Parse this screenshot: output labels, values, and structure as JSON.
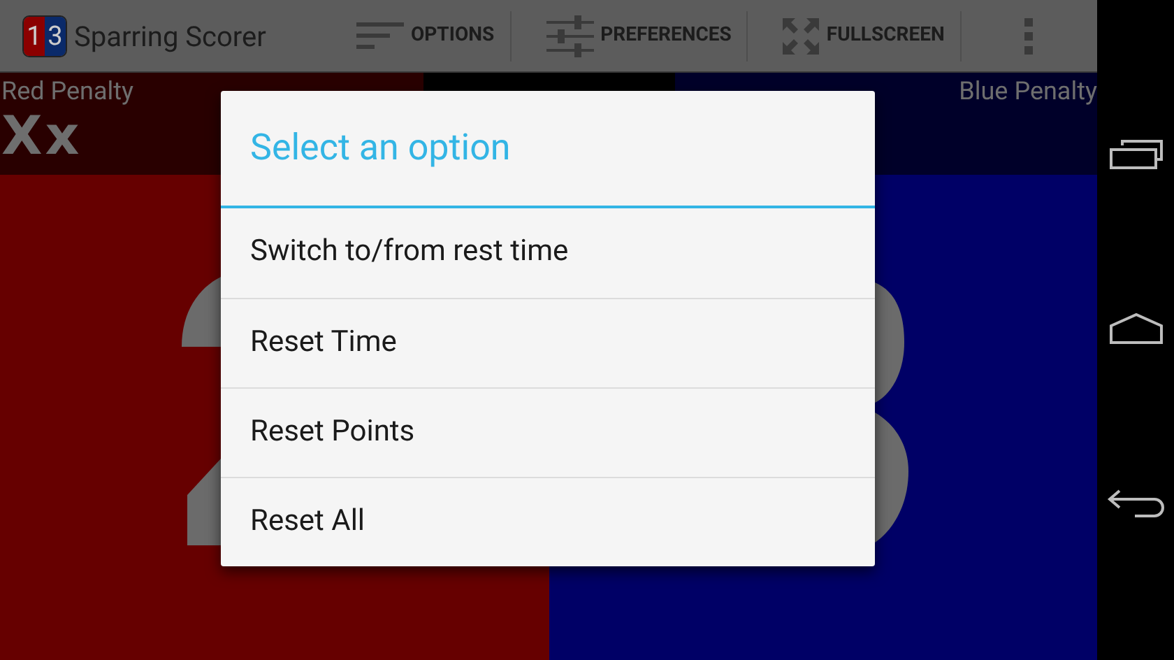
{
  "app_bar": {
    "logo": [
      {
        "text": "1",
        "color": "#8b0000"
      },
      {
        "text": "3",
        "color": "#0a2a6a"
      }
    ],
    "title": "Sparring Scorer",
    "actions": [
      {
        "kind": "options",
        "label": "OPTIONS"
      },
      {
        "kind": "preferences",
        "label": "PREFERENCES"
      },
      {
        "kind": "fullscreen",
        "label": "FULLSCREEN"
      }
    ]
  },
  "red": {
    "penalty_label": "Red Penalty",
    "penalty_marks": "Xx"
  },
  "blue": {
    "penalty_label": "Blue Penalty"
  },
  "dialog": {
    "title": "Select an option",
    "items": [
      "Switch to/from rest time",
      "Reset Time",
      "Reset Points",
      "Reset All"
    ]
  }
}
